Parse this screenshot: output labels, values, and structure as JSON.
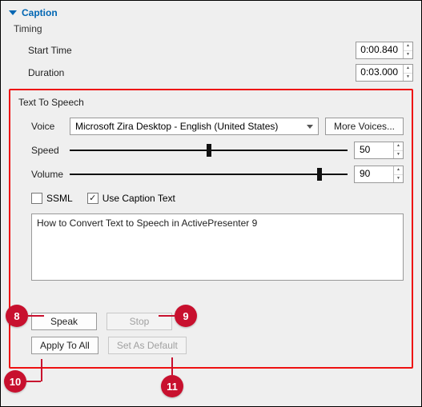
{
  "header": {
    "caption_label": "Caption"
  },
  "timing": {
    "title": "Timing",
    "start_time_label": "Start Time",
    "start_time_value": "0:00.840",
    "duration_label": "Duration",
    "duration_value": "0:03.000"
  },
  "tts": {
    "title": "Text To Speech",
    "voice_label": "Voice",
    "voice_value": "Microsoft Zira Desktop - English (United States)",
    "more_voices_label": "More Voices...",
    "speed_label": "Speed",
    "speed_value": "50",
    "speed_pct": 50,
    "volume_label": "Volume",
    "volume_value": "90",
    "volume_pct": 90,
    "ssml_label": "SSML",
    "ssml_checked": false,
    "use_caption_label": "Use Caption Text",
    "use_caption_checked": true,
    "text_value": "How to Convert Text to Speech in ActivePresenter 9",
    "speak_label": "Speak",
    "stop_label": "Stop",
    "apply_all_label": "Apply To All",
    "set_default_label": "Set As Default"
  },
  "callouts": {
    "c8": "8",
    "c9": "9",
    "c10": "10",
    "c11": "11"
  }
}
